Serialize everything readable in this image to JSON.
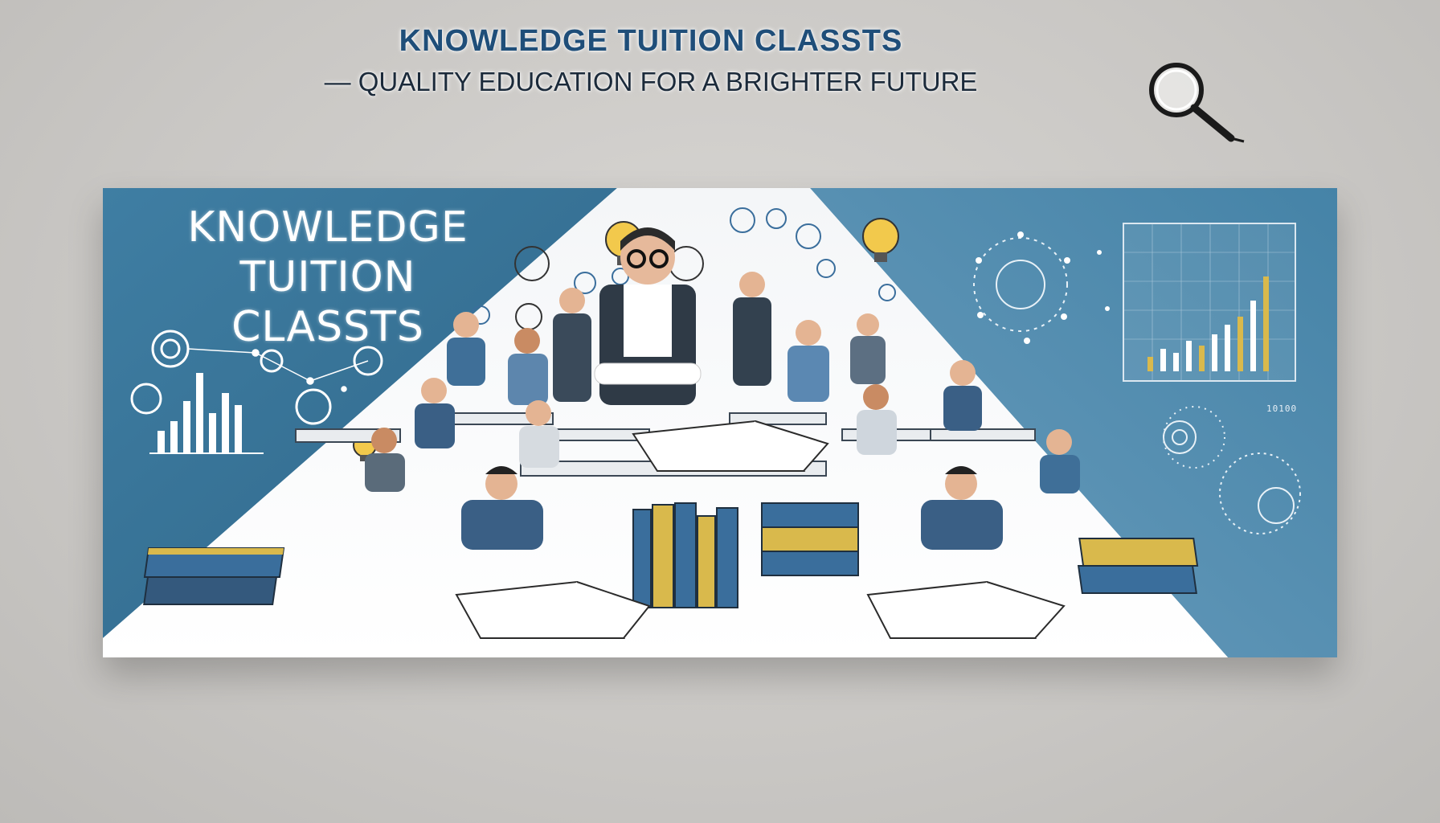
{
  "header": {
    "title": "KNOWLEDGE TUITION CLASSTS",
    "tagline": "— QUALITY EDUCATION FOR A BRIGHTER FUTURE"
  },
  "banner": {
    "title_lines": [
      "KNOWLEDGE",
      "TUITION",
      "CLASSTS"
    ],
    "chart_caption": "10100"
  },
  "icons": {
    "top_right": "magnifying-glass-icon",
    "decorations": [
      "lightbulb-icon",
      "gear-icon",
      "network-icon",
      "bar-chart-icon",
      "book-stack-icon"
    ]
  },
  "colors": {
    "banner_blue": "#3f7ea3",
    "banner_blue_dark": "#2f6688",
    "title_navy": "#1f4e79",
    "book_blue": "#3a6e9c",
    "book_gold": "#d9b94c",
    "background_grey": "#cfcdca"
  }
}
